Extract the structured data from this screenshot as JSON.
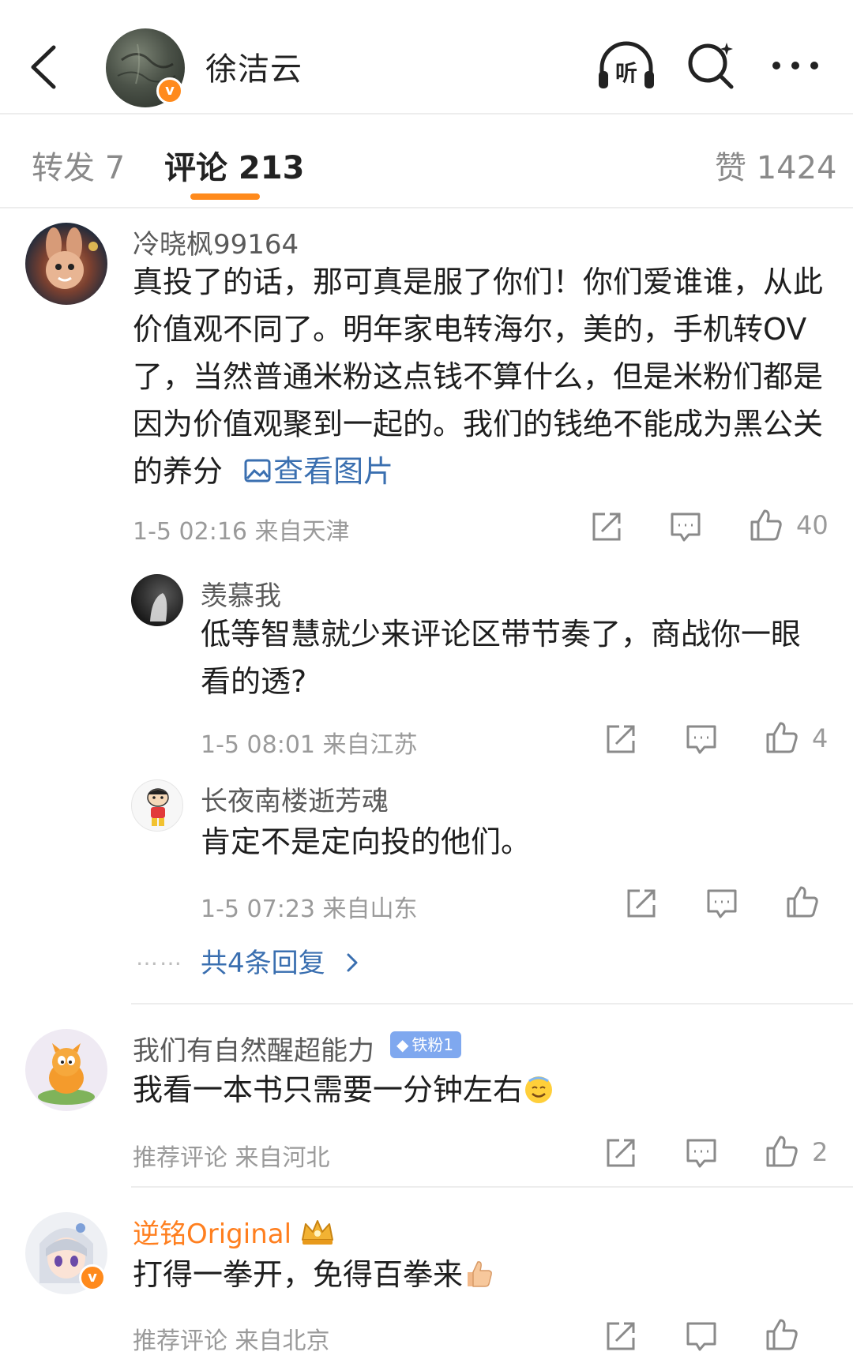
{
  "header": {
    "title": "徐洁云",
    "verified_mark": "v"
  },
  "tabs": {
    "repost": "转发 7",
    "comments": "评论 213",
    "likes": "赞 1424"
  },
  "comments": [
    {
      "user": "冷晓枫99164",
      "text": "真投了的话，那可真是服了你们！你们爱谁谁，从此价值观不同了。明年家电转海尔，美的，手机转OV了，当然普通米粉这点钱不算什么，但是米粉们都是因为价值观聚到一起的。我们的钱绝不能成为黑公关的养分",
      "image_link": "查看图片",
      "meta": "1-5 02:16  来自天津",
      "likes": "40",
      "replies": [
        {
          "user": "羡慕我",
          "text": "低等智慧就少来评论区带节奏了，商战你一眼看的透?",
          "meta": "1-5 08:01  来自江苏",
          "likes": "4"
        },
        {
          "user": "长夜南楼逝芳魂",
          "text": "肯定不是定向投的他们。",
          "meta": "1-5 07:23  来自山东",
          "likes": ""
        }
      ],
      "more_replies": "共4条回复",
      "more_dots": "……"
    },
    {
      "user": "我们有自然醒超能力",
      "fan_badge": "铁粉1",
      "text": "我看一本书只需要一分钟左右",
      "meta": "推荐评论  来自河北",
      "likes": "2"
    },
    {
      "user": "逆铭Original",
      "text": "打得一拳开，免得百拳来",
      "meta": "推荐评论  来自北京",
      "likes": ""
    }
  ],
  "colors": {
    "accent": "#ff8a1c",
    "link": "#3a6fb0",
    "vip_name": "#ff7f1f",
    "fan_badge": "#7fa8ef"
  }
}
